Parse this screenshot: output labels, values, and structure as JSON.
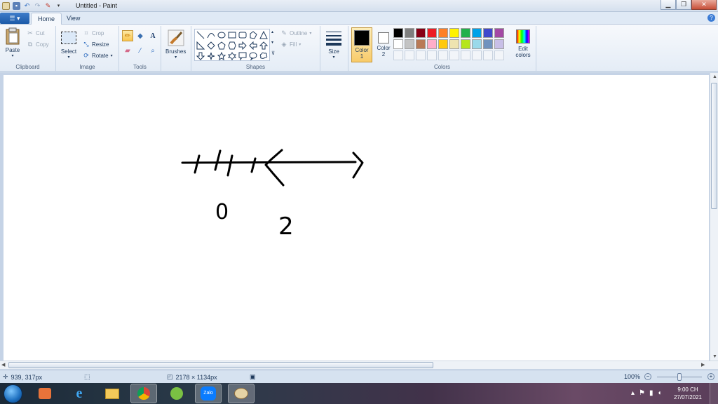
{
  "window": {
    "title": "Untitled - Paint",
    "minimize_icon": "minimize-icon",
    "maximize_icon": "restore-icon",
    "close_icon": "close-icon"
  },
  "tabs": {
    "file_label": "☰ ▾",
    "home": "Home",
    "view": "View"
  },
  "ribbon": {
    "clipboard": {
      "group": "Clipboard",
      "paste": "Paste",
      "cut": "Cut",
      "copy": "Copy"
    },
    "image": {
      "group": "Image",
      "select": "Select",
      "crop": "Crop",
      "resize": "Resize",
      "rotate": "Rotate"
    },
    "tools": {
      "group": "Tools"
    },
    "brushes": {
      "label": "Brushes"
    },
    "shapes": {
      "group": "Shapes",
      "outline": "Outline",
      "fill": "Fill"
    },
    "size": {
      "label": "Size"
    },
    "colors": {
      "group": "Colors",
      "color1": "Color 1",
      "color2": "Color 2",
      "edit": "Edit colors",
      "color1_value": "#000000",
      "color2_value": "#ffffff",
      "palette": [
        "#000000",
        "#7f7f7f",
        "#880015",
        "#ed1c24",
        "#ff7f27",
        "#fff200",
        "#22b14c",
        "#00a2e8",
        "#3f48cc",
        "#a349a4",
        "#ffffff",
        "#c3c3c3",
        "#b97a57",
        "#ffaec9",
        "#ffc90e",
        "#efe4b0",
        "#b5e61d",
        "#99d9ea",
        "#7092be",
        "#c8bfe7"
      ]
    }
  },
  "canvas": {
    "drawing_labels": {
      "zero": "0",
      "two": "2"
    }
  },
  "status": {
    "cursor": "939, 317px",
    "image_size": "2178 × 1134px",
    "zoom": "100%"
  },
  "taskbar": {
    "time": "9:00 CH",
    "date": "27/07/2021",
    "zalo": "Zalo"
  }
}
